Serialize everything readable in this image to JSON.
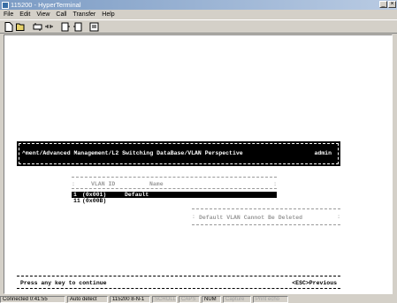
{
  "window": {
    "title": "115200 - HyperTerminal",
    "close_glyph": "×",
    "minimize_glyph": "_"
  },
  "menu": [
    "File",
    "Edit",
    "View",
    "Call",
    "Transfer",
    "Help"
  ],
  "toolbar": {
    "buttons": [
      {
        "name": "new-icon"
      },
      {
        "name": "open-icon"
      },
      {
        "name": "connect-icon"
      },
      {
        "name": "disconnect-icon"
      },
      {
        "name": "send-icon"
      },
      {
        "name": "receive-icon"
      },
      {
        "name": "properties-icon"
      }
    ]
  },
  "terminal": {
    "header_title": "^ment/Advanced Management/L2 Switching DataBase/VLAN Perspective",
    "header_user": "admin",
    "table": {
      "col_vlan": "VLAN ID",
      "col_name": "Name",
      "rows": [
        {
          "mark": "1",
          "id": "(0x001)",
          "name": "Default",
          "selected": true
        },
        {
          "mark": "11",
          "id": "(0x00B)",
          "name": "",
          "selected": false
        }
      ]
    },
    "message": "Default VLAN Cannot Be Deleted",
    "footer_left": "Press any key to continue",
    "footer_right": "<ESC>Previous"
  },
  "status": {
    "connected": "Connected 0:41:55",
    "detect": "Auto detect",
    "settings": "115200 8-N-1",
    "scroll": "SCROLL",
    "caps": "CAPS",
    "num": "NUM",
    "capture": "Capture",
    "print_echo": "Print echo"
  }
}
